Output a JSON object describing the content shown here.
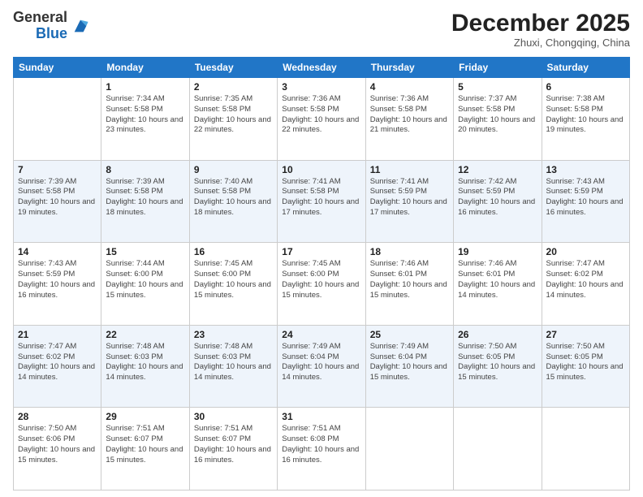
{
  "header": {
    "logo": {
      "general": "General",
      "blue": "Blue"
    },
    "title": "December 2025",
    "subtitle": "Zhuxi, Chongqing, China"
  },
  "days_of_week": [
    "Sunday",
    "Monday",
    "Tuesday",
    "Wednesday",
    "Thursday",
    "Friday",
    "Saturday"
  ],
  "weeks": [
    [
      {
        "day": "",
        "sunrise": "",
        "sunset": "",
        "daylight": ""
      },
      {
        "day": "1",
        "sunrise": "Sunrise: 7:34 AM",
        "sunset": "Sunset: 5:58 PM",
        "daylight": "Daylight: 10 hours and 23 minutes."
      },
      {
        "day": "2",
        "sunrise": "Sunrise: 7:35 AM",
        "sunset": "Sunset: 5:58 PM",
        "daylight": "Daylight: 10 hours and 22 minutes."
      },
      {
        "day": "3",
        "sunrise": "Sunrise: 7:36 AM",
        "sunset": "Sunset: 5:58 PM",
        "daylight": "Daylight: 10 hours and 22 minutes."
      },
      {
        "day": "4",
        "sunrise": "Sunrise: 7:36 AM",
        "sunset": "Sunset: 5:58 PM",
        "daylight": "Daylight: 10 hours and 21 minutes."
      },
      {
        "day": "5",
        "sunrise": "Sunrise: 7:37 AM",
        "sunset": "Sunset: 5:58 PM",
        "daylight": "Daylight: 10 hours and 20 minutes."
      },
      {
        "day": "6",
        "sunrise": "Sunrise: 7:38 AM",
        "sunset": "Sunset: 5:58 PM",
        "daylight": "Daylight: 10 hours and 19 minutes."
      }
    ],
    [
      {
        "day": "7",
        "sunrise": "Sunrise: 7:39 AM",
        "sunset": "Sunset: 5:58 PM",
        "daylight": "Daylight: 10 hours and 19 minutes."
      },
      {
        "day": "8",
        "sunrise": "Sunrise: 7:39 AM",
        "sunset": "Sunset: 5:58 PM",
        "daylight": "Daylight: 10 hours and 18 minutes."
      },
      {
        "day": "9",
        "sunrise": "Sunrise: 7:40 AM",
        "sunset": "Sunset: 5:58 PM",
        "daylight": "Daylight: 10 hours and 18 minutes."
      },
      {
        "day": "10",
        "sunrise": "Sunrise: 7:41 AM",
        "sunset": "Sunset: 5:58 PM",
        "daylight": "Daylight: 10 hours and 17 minutes."
      },
      {
        "day": "11",
        "sunrise": "Sunrise: 7:41 AM",
        "sunset": "Sunset: 5:59 PM",
        "daylight": "Daylight: 10 hours and 17 minutes."
      },
      {
        "day": "12",
        "sunrise": "Sunrise: 7:42 AM",
        "sunset": "Sunset: 5:59 PM",
        "daylight": "Daylight: 10 hours and 16 minutes."
      },
      {
        "day": "13",
        "sunrise": "Sunrise: 7:43 AM",
        "sunset": "Sunset: 5:59 PM",
        "daylight": "Daylight: 10 hours and 16 minutes."
      }
    ],
    [
      {
        "day": "14",
        "sunrise": "Sunrise: 7:43 AM",
        "sunset": "Sunset: 5:59 PM",
        "daylight": "Daylight: 10 hours and 16 minutes."
      },
      {
        "day": "15",
        "sunrise": "Sunrise: 7:44 AM",
        "sunset": "Sunset: 6:00 PM",
        "daylight": "Daylight: 10 hours and 15 minutes."
      },
      {
        "day": "16",
        "sunrise": "Sunrise: 7:45 AM",
        "sunset": "Sunset: 6:00 PM",
        "daylight": "Daylight: 10 hours and 15 minutes."
      },
      {
        "day": "17",
        "sunrise": "Sunrise: 7:45 AM",
        "sunset": "Sunset: 6:00 PM",
        "daylight": "Daylight: 10 hours and 15 minutes."
      },
      {
        "day": "18",
        "sunrise": "Sunrise: 7:46 AM",
        "sunset": "Sunset: 6:01 PM",
        "daylight": "Daylight: 10 hours and 15 minutes."
      },
      {
        "day": "19",
        "sunrise": "Sunrise: 7:46 AM",
        "sunset": "Sunset: 6:01 PM",
        "daylight": "Daylight: 10 hours and 14 minutes."
      },
      {
        "day": "20",
        "sunrise": "Sunrise: 7:47 AM",
        "sunset": "Sunset: 6:02 PM",
        "daylight": "Daylight: 10 hours and 14 minutes."
      }
    ],
    [
      {
        "day": "21",
        "sunrise": "Sunrise: 7:47 AM",
        "sunset": "Sunset: 6:02 PM",
        "daylight": "Daylight: 10 hours and 14 minutes."
      },
      {
        "day": "22",
        "sunrise": "Sunrise: 7:48 AM",
        "sunset": "Sunset: 6:03 PM",
        "daylight": "Daylight: 10 hours and 14 minutes."
      },
      {
        "day": "23",
        "sunrise": "Sunrise: 7:48 AM",
        "sunset": "Sunset: 6:03 PM",
        "daylight": "Daylight: 10 hours and 14 minutes."
      },
      {
        "day": "24",
        "sunrise": "Sunrise: 7:49 AM",
        "sunset": "Sunset: 6:04 PM",
        "daylight": "Daylight: 10 hours and 14 minutes."
      },
      {
        "day": "25",
        "sunrise": "Sunrise: 7:49 AM",
        "sunset": "Sunset: 6:04 PM",
        "daylight": "Daylight: 10 hours and 15 minutes."
      },
      {
        "day": "26",
        "sunrise": "Sunrise: 7:50 AM",
        "sunset": "Sunset: 6:05 PM",
        "daylight": "Daylight: 10 hours and 15 minutes."
      },
      {
        "day": "27",
        "sunrise": "Sunrise: 7:50 AM",
        "sunset": "Sunset: 6:05 PM",
        "daylight": "Daylight: 10 hours and 15 minutes."
      }
    ],
    [
      {
        "day": "28",
        "sunrise": "Sunrise: 7:50 AM",
        "sunset": "Sunset: 6:06 PM",
        "daylight": "Daylight: 10 hours and 15 minutes."
      },
      {
        "day": "29",
        "sunrise": "Sunrise: 7:51 AM",
        "sunset": "Sunset: 6:07 PM",
        "daylight": "Daylight: 10 hours and 15 minutes."
      },
      {
        "day": "30",
        "sunrise": "Sunrise: 7:51 AM",
        "sunset": "Sunset: 6:07 PM",
        "daylight": "Daylight: 10 hours and 16 minutes."
      },
      {
        "day": "31",
        "sunrise": "Sunrise: 7:51 AM",
        "sunset": "Sunset: 6:08 PM",
        "daylight": "Daylight: 10 hours and 16 minutes."
      },
      {
        "day": "",
        "sunrise": "",
        "sunset": "",
        "daylight": ""
      },
      {
        "day": "",
        "sunrise": "",
        "sunset": "",
        "daylight": ""
      },
      {
        "day": "",
        "sunrise": "",
        "sunset": "",
        "daylight": ""
      }
    ]
  ]
}
